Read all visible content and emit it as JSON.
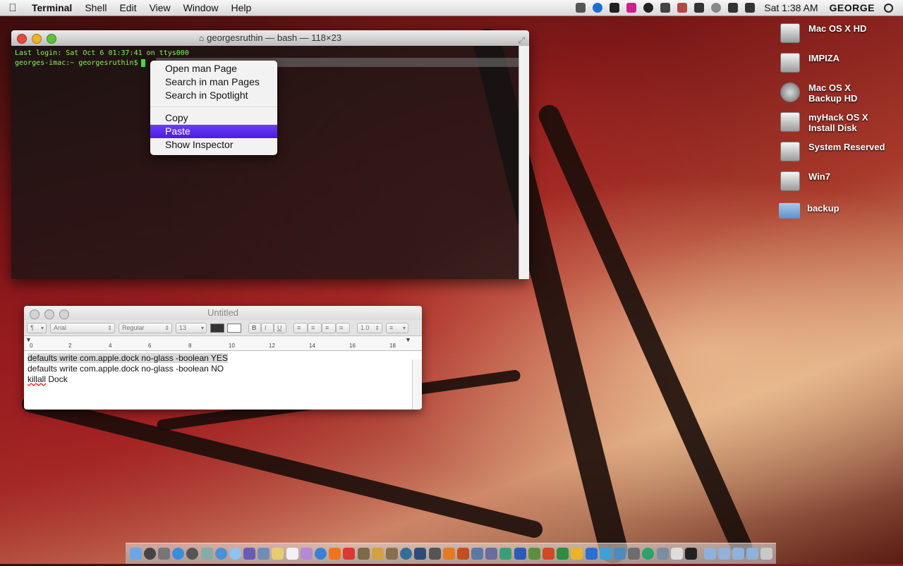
{
  "menubar": {
    "app_name": "Terminal",
    "items": [
      "Shell",
      "Edit",
      "View",
      "Window",
      "Help"
    ],
    "clock": "Sat 1:38 AM",
    "user": "GEORGE"
  },
  "terminal": {
    "title": "georgesruthin — bash — 118×23",
    "lines": [
      "Last login: Sat Oct  6 01:37:41 on ttys000",
      "georges-imac:~ georgesruthin$"
    ]
  },
  "context_menu": {
    "items": [
      "Open man Page",
      "Search in man Pages",
      "Search in Spotlight",
      "Copy",
      "Paste",
      "Show Inspector"
    ],
    "selected": "Paste"
  },
  "textedit": {
    "title": "Untitled",
    "font": "Arial",
    "style": "Regular",
    "size": "13",
    "line_spacing": "1.0",
    "ruler_labels": [
      "0",
      "2",
      "4",
      "6",
      "8",
      "10",
      "12",
      "14",
      "16",
      "18"
    ],
    "lines": [
      "defaults write com.apple.dock no-glass -boolean YES",
      "defaults write com.apple.dock no-glass -boolean NO",
      "killall Dock"
    ]
  },
  "desktop": {
    "icons": [
      {
        "label": "Mac OS X HD"
      },
      {
        "label": "IMPIZA"
      },
      {
        "label": "Mac OS X Backup HD"
      },
      {
        "label": "myHack OS X Install Disk"
      },
      {
        "label": "System Reserved"
      },
      {
        "label": "Win7"
      },
      {
        "label": "backup"
      }
    ]
  },
  "colors": {
    "menu_selection": "#5a28ee",
    "terminal_text": "#8ef25f"
  }
}
